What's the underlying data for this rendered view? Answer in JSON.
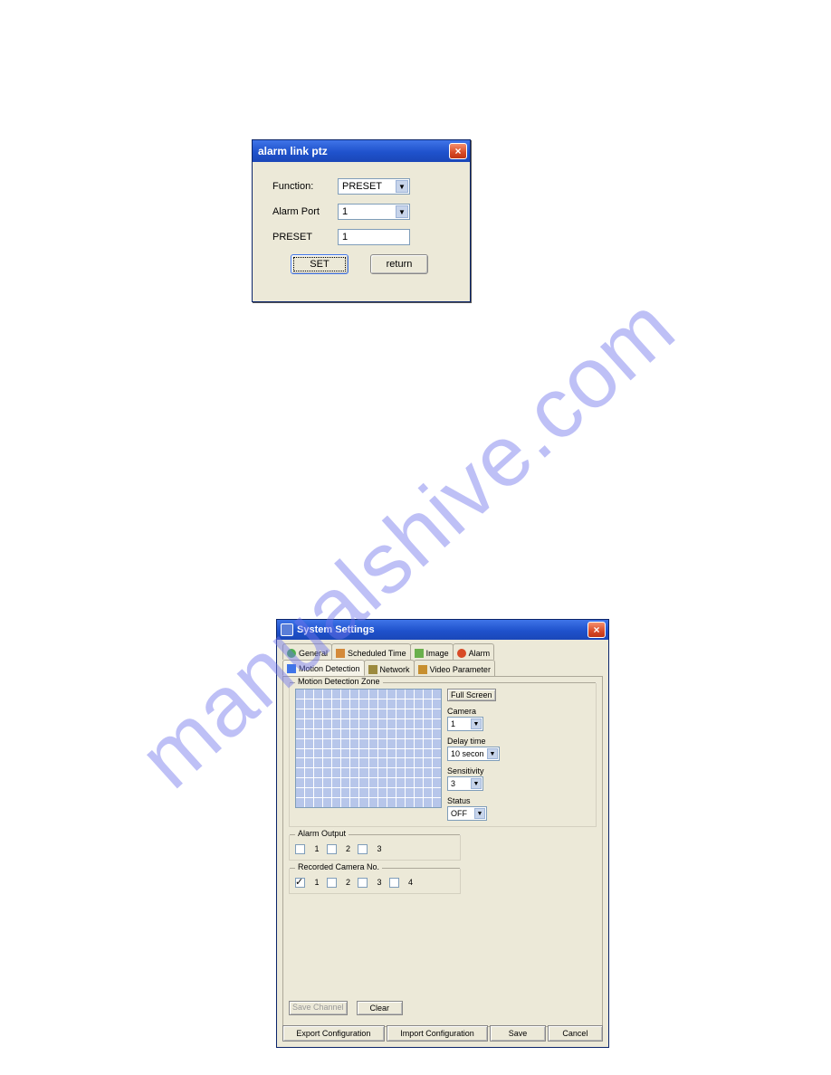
{
  "watermark": "manualshive.com",
  "dialog1": {
    "title": "alarm link ptz",
    "close": "×",
    "labels": {
      "function": "Function:",
      "alarm_port": "Alarm Port",
      "preset": "PRESET"
    },
    "function_value": "PRESET",
    "alarm_port_value": "1",
    "preset_value": "1",
    "buttons": {
      "set": "SET",
      "return": "return"
    }
  },
  "dialog2": {
    "title": "System Settings",
    "close": "×",
    "tabs": {
      "general": "General",
      "scheduled_time": "Scheduled Time",
      "image": "Image",
      "alarm": "Alarm",
      "motion_detection": "Motion Detection",
      "network": "Network",
      "video_parameter": "Video Parameter"
    },
    "active_tab": "Motion Detection",
    "zone_group_title": "Motion Detection Zone",
    "full_screen_btn": "Full Screen",
    "camera_label": "Camera",
    "camera_value": "1",
    "delay_label": "Delay time",
    "delay_value": "10 secon",
    "sensitivity_label": "Sensitivity",
    "sensitivity_value": "3",
    "status_label": "Status",
    "status_value": "OFF",
    "alarm_output_title": "Alarm Output",
    "alarm_output": [
      {
        "label": "1",
        "checked": false
      },
      {
        "label": "2",
        "checked": false
      },
      {
        "label": "3",
        "checked": false
      }
    ],
    "recorded_camera_title": "Recorded Camera No.",
    "recorded_camera": [
      {
        "label": "1",
        "checked": true
      },
      {
        "label": "2",
        "checked": false
      },
      {
        "label": "3",
        "checked": false
      },
      {
        "label": "4",
        "checked": false
      }
    ],
    "save_channel_btn": "Save Channel",
    "clear_btn": "Clear",
    "footer": {
      "export": "Export Configuration",
      "import": "Import Configuration",
      "save": "Save",
      "cancel": "Cancel"
    }
  }
}
